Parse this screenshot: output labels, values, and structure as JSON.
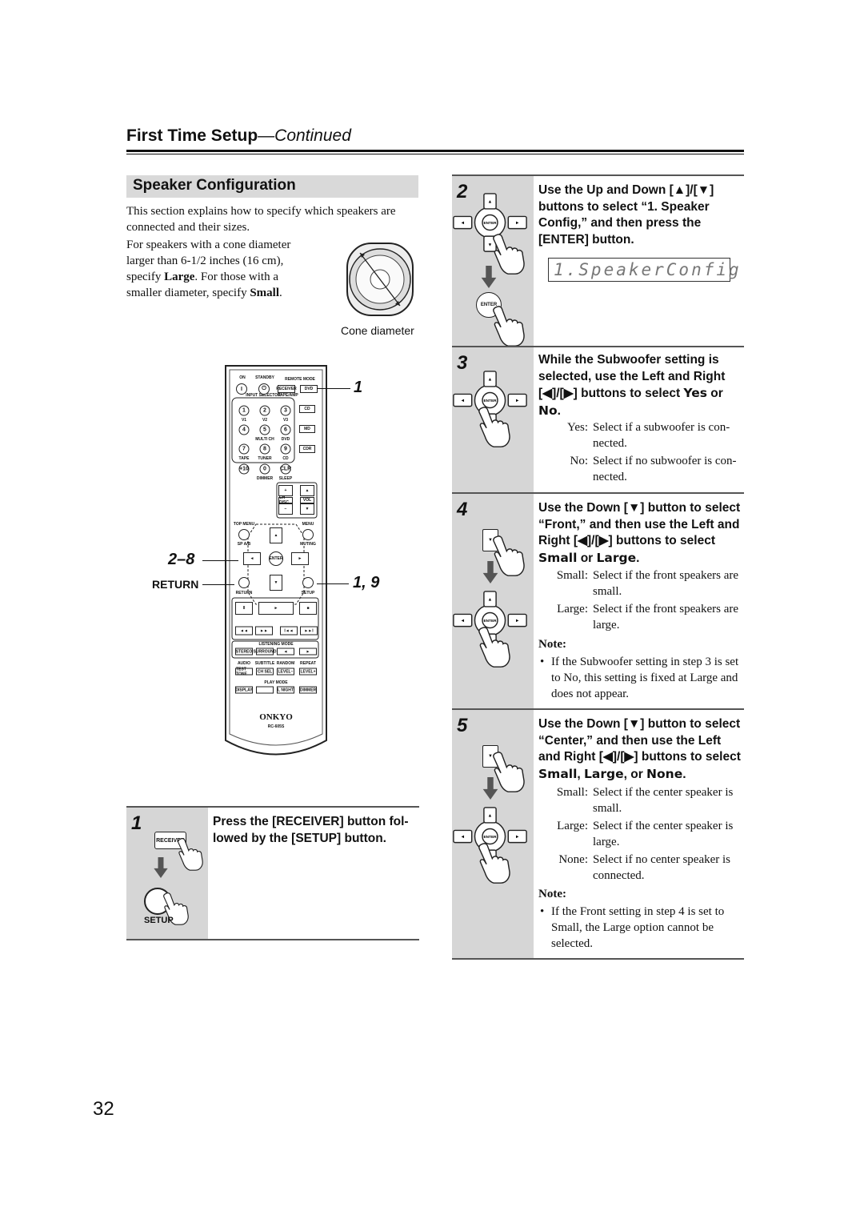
{
  "header": {
    "title": "First Time Setup",
    "continued": "—Continued"
  },
  "section": {
    "title": "Speaker Configuration"
  },
  "intro": {
    "p1": "This section explains how to specify which speakers are connected and their sizes.",
    "p2_a": "For speakers with a cone diameter larger than 6-1/2 inches (16 cm), specify ",
    "p2_large": "Large",
    "p2_b": ". For those with a smaller diameter, specify ",
    "p2_small": "Small",
    "p2_c": ".",
    "cone_caption": "Cone diameter"
  },
  "remote": {
    "labels": [
      "ON",
      "STANDBY",
      "REMOTE MODE",
      "TAPE/AMP",
      "INPUT SELECTOR",
      "V1",
      "V2",
      "V3",
      "MULTI CH",
      "DVD",
      "TAPE",
      "TUNER",
      "CD",
      "DIMMER",
      "SLEEP",
      "TOP MENU",
      "MENU",
      "SP A/B",
      "MUTING",
      "RETURN",
      "SETUP",
      "LISTENING MODE",
      "AUDIO",
      "SUBTITLE",
      "RANDOM",
      "REPEAT",
      "PLAY MODE",
      "RC-605S"
    ],
    "buttons": [
      "I",
      "⏻",
      "RECEIVER",
      "DVD",
      "1",
      "2",
      "3",
      "4",
      "5",
      "6",
      "7",
      "8",
      "9",
      "+10",
      "0",
      "CLR",
      "CD",
      "MD",
      "CDR",
      "+",
      "−",
      "▲",
      "▼",
      "CH DISC",
      "VOL",
      "▲",
      "◄",
      "ENTER",
      "►",
      "▼",
      "II",
      "►",
      "■",
      "◄◄",
      "►►",
      "I◄◄",
      "►►I",
      "STEREO",
      "SURROUND",
      "◄",
      "►",
      "TEST TONE",
      "CH SEL",
      "LEVEL−",
      "LEVEL+",
      "DISPLAY",
      "",
      "L NIGHT",
      "DIMMER"
    ],
    "brand": "ONKYO"
  },
  "callouts": {
    "c1": "1",
    "c28": "2–8",
    "return": "RETURN",
    "c19": "1, 9"
  },
  "step1": {
    "num": "1",
    "text": "Press the [RECEIVER] button fol-lowed by the [SETUP] button.",
    "receiver": "RECEIVER",
    "setup": "SETUP"
  },
  "step2": {
    "num": "2",
    "text": "Use the Up and Down [▲]/[▼] buttons to select “1. Speaker Config,” and then press the [ENTER] button.",
    "display": "1.SpeakerConfig",
    "enter": "ENTER"
  },
  "step3": {
    "num": "3",
    "text_a": "While the Subwoofer setting is selected, use the Left and Right [◀]/[▶] buttons to select ",
    "yes": "Yes",
    "or": " or ",
    "no": "No",
    "end": ".",
    "defs": [
      {
        "term": "Yes:",
        "desc": "Select if a subwoofer is con-nected."
      },
      {
        "term": "No:",
        "desc": "Select if no subwoofer is con-nected."
      }
    ]
  },
  "step4": {
    "num": "4",
    "text_a": "Use the Down [▼] button to select “Front,” and then use the Left and Right [◀]/[▶] buttons to select ",
    "small": "Small",
    "or": " or ",
    "large": "Large",
    "end": ".",
    "defs": [
      {
        "term": "Small:",
        "desc": "Select if the front speakers are small."
      },
      {
        "term": "Large:",
        "desc": "Select if the front speakers are large."
      }
    ],
    "note_title": "Note:",
    "note": "If the Subwoofer setting in step 3 is set to No, this setting is fixed at Large and does not appear."
  },
  "step5": {
    "num": "5",
    "text_a": "Use the Down [▼] button to select “Center,” and then use the Left and Right [◀]/[▶] buttons to select ",
    "small": "Small",
    "c1": ", ",
    "large": "Large",
    "c2": ", or ",
    "none": "None",
    "end": ".",
    "defs": [
      {
        "term": "Small:",
        "desc": "Select if the center speaker is small."
      },
      {
        "term": "Large:",
        "desc": "Select if the center speaker is large."
      },
      {
        "term": "None:",
        "desc": "Select if no center speaker is connected."
      }
    ],
    "note_title": "Note:",
    "note": "If the Front setting in step 4 is set to Small, the Large option cannot be selected."
  },
  "page_number": "32"
}
